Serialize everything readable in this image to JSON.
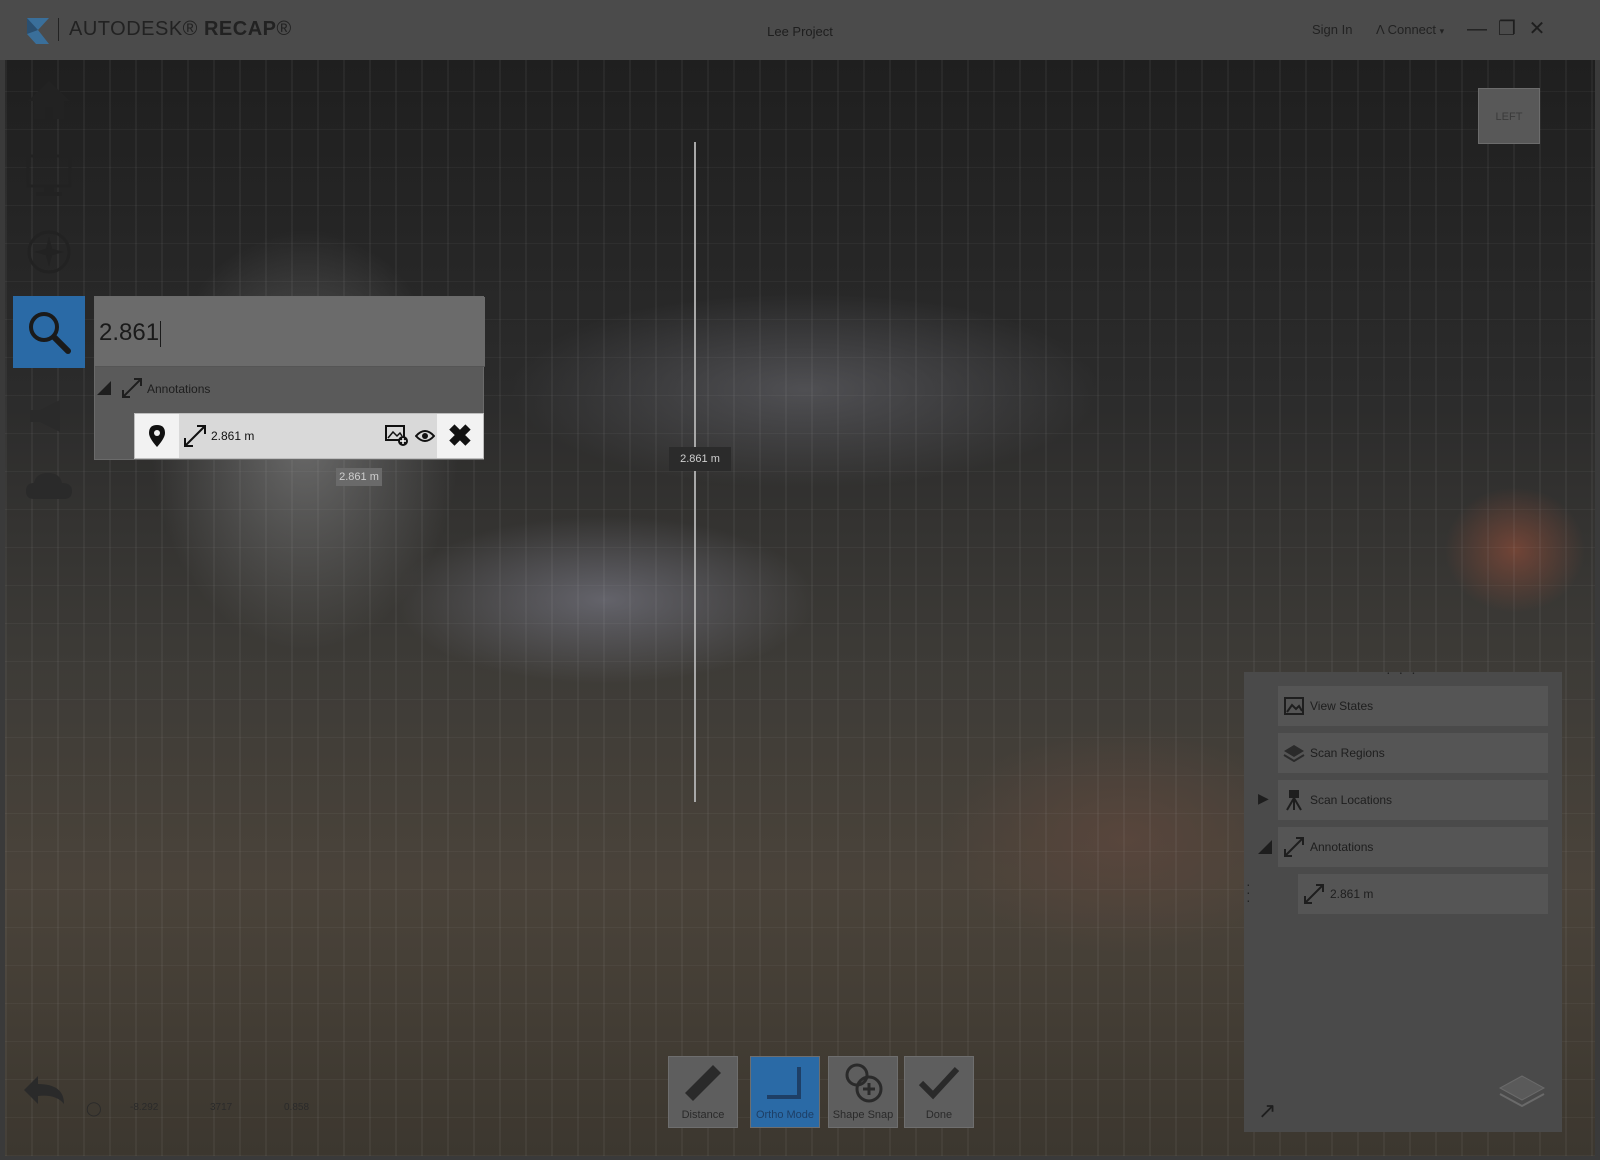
{
  "app": {
    "brand": "AUTODESK",
    "product": "RECAP",
    "project": "Lee Project"
  },
  "titlebar": {
    "sign_in": "Sign In",
    "connect": "Connect"
  },
  "search": {
    "value": "2.861",
    "group_label": "Annotations"
  },
  "result": {
    "label": "2.861 m"
  },
  "viewport": {
    "measure_label": "2.861 m",
    "measure_label_faded": "2.861 m",
    "navcube_face": "LEFT"
  },
  "right_panel": {
    "items": [
      {
        "label": "View States"
      },
      {
        "label": "Scan Regions"
      },
      {
        "label": "Scan Locations"
      },
      {
        "label": "Annotations"
      },
      {
        "label": "2.861 m"
      }
    ]
  },
  "toolbar": {
    "distance": "Distance",
    "ortho": "Ortho Mode",
    "shape_snap": "Shape Snap",
    "done": "Done"
  },
  "status": {
    "a": "-8.292",
    "b": "3717",
    "c": "0.858"
  },
  "colors": {
    "accent": "#2a6aa6",
    "titlebar": "#4b4b4b"
  }
}
